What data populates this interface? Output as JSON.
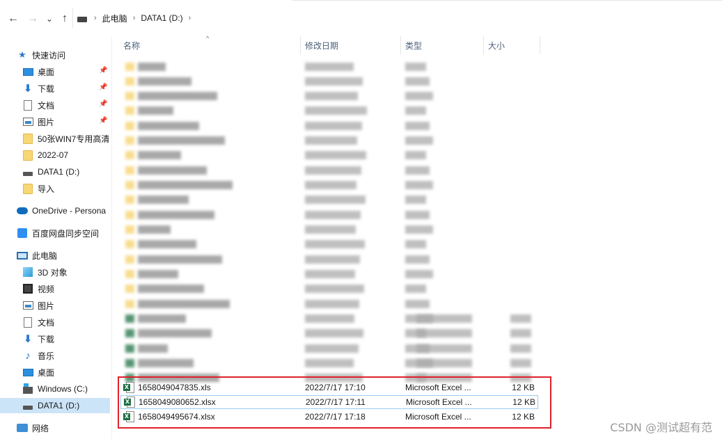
{
  "nav": {
    "back_icon": "←",
    "forward_icon": "→",
    "recent_icon": "⌄",
    "up_icon": "↑"
  },
  "breadcrumb": {
    "items": [
      "此电脑",
      "DATA1 (D:)"
    ],
    "separator": "›"
  },
  "columns": {
    "name": "名称",
    "date": "修改日期",
    "type": "类型",
    "size": "大小"
  },
  "sidebar": {
    "quick_access": "快速访问",
    "quick_items": [
      {
        "label": "桌面",
        "icon": "desktop-icon",
        "pinned": true
      },
      {
        "label": "下载",
        "icon": "download-icon",
        "pinned": true
      },
      {
        "label": "文档",
        "icon": "document-icon",
        "pinned": true
      },
      {
        "label": "图片",
        "icon": "picture-icon",
        "pinned": true
      },
      {
        "label": "50张WIN7专用高清",
        "icon": "folder-icon"
      },
      {
        "label": "2022-07",
        "icon": "folder-icon"
      },
      {
        "label": "DATA1 (D:)",
        "icon": "drive-icon"
      },
      {
        "label": "导入",
        "icon": "folder-icon"
      }
    ],
    "onedrive": "OneDrive - Persona",
    "baidu": "百度网盘同步空间",
    "this_pc": "此电脑",
    "pc_items": [
      {
        "label": "3D 对象",
        "icon": "cube-icon"
      },
      {
        "label": "视频",
        "icon": "video-icon"
      },
      {
        "label": "图片",
        "icon": "picture-icon"
      },
      {
        "label": "文档",
        "icon": "document-icon"
      },
      {
        "label": "下载",
        "icon": "download-icon"
      },
      {
        "label": "音乐",
        "icon": "music-icon"
      },
      {
        "label": "桌面",
        "icon": "desktop-icon"
      },
      {
        "label": "Windows (C:)",
        "icon": "windows-drive-icon"
      },
      {
        "label": "DATA1 (D:)",
        "icon": "drive-icon",
        "selected": true
      }
    ],
    "network": "网络"
  },
  "files": [
    {
      "name": "1658049047835.xls",
      "date": "2022/7/17 17:10",
      "type": "Microsoft Excel ...",
      "size": "12 KB"
    },
    {
      "name": "1658049080652.xlsx",
      "date": "2022/7/17 17:11",
      "type": "Microsoft Excel ...",
      "size": "12 KB"
    },
    {
      "name": "1658049495674.xlsx",
      "date": "2022/7/17 17:18",
      "type": "Microsoft Excel ...",
      "size": "12 KB"
    }
  ],
  "watermark": "CSDN @测试超有范",
  "colors": {
    "highlight_border": "#e0202a",
    "selection": "#cce4f7",
    "excel_green": "#1d6f42"
  }
}
